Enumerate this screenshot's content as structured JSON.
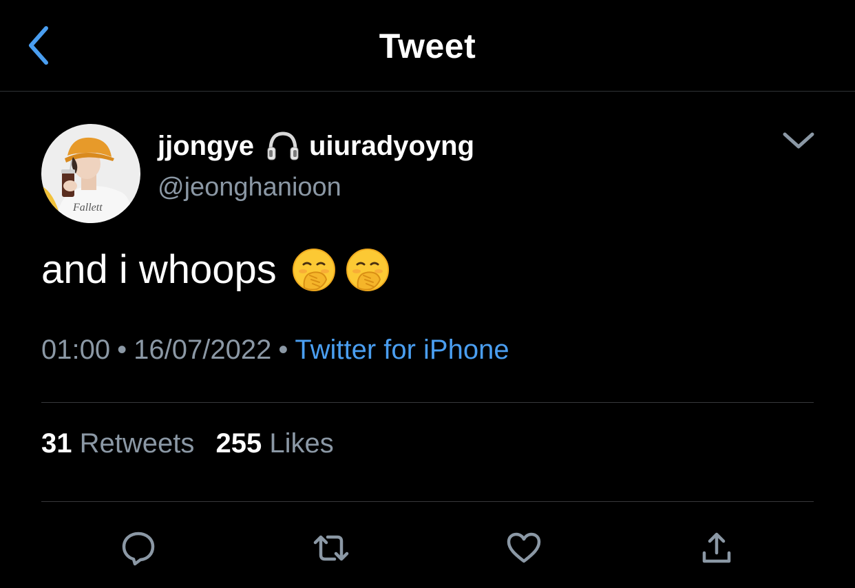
{
  "header": {
    "title": "Tweet",
    "back_icon": "chevron-left-icon",
    "accent_color": "#4a9ef0"
  },
  "tweet": {
    "author": {
      "name_part1": "jjongye",
      "name_icon": "headphones-icon",
      "name_part2": "uiuradyoyng",
      "handle": "@jeonghanioon",
      "avatar_text": "Fallett"
    },
    "text": "and i whoops",
    "emojis": [
      "face-with-hand-over-mouth",
      "face-with-hand-over-mouth"
    ],
    "time": "01:00",
    "date": "16/07/2022",
    "separator": "•",
    "source": "Twitter for iPhone",
    "stats": {
      "retweets_count": "31",
      "retweets_label": "Retweets",
      "likes_count": "255",
      "likes_label": "Likes"
    }
  },
  "actions": {
    "reply_icon": "reply-icon",
    "retweet_icon": "retweet-icon",
    "like_icon": "heart-icon",
    "share_icon": "share-icon"
  },
  "colors": {
    "background": "#000000",
    "text_primary": "#ffffff",
    "text_secondary": "#8b98a5",
    "link": "#4a9ef0",
    "divider": "#38393c"
  }
}
